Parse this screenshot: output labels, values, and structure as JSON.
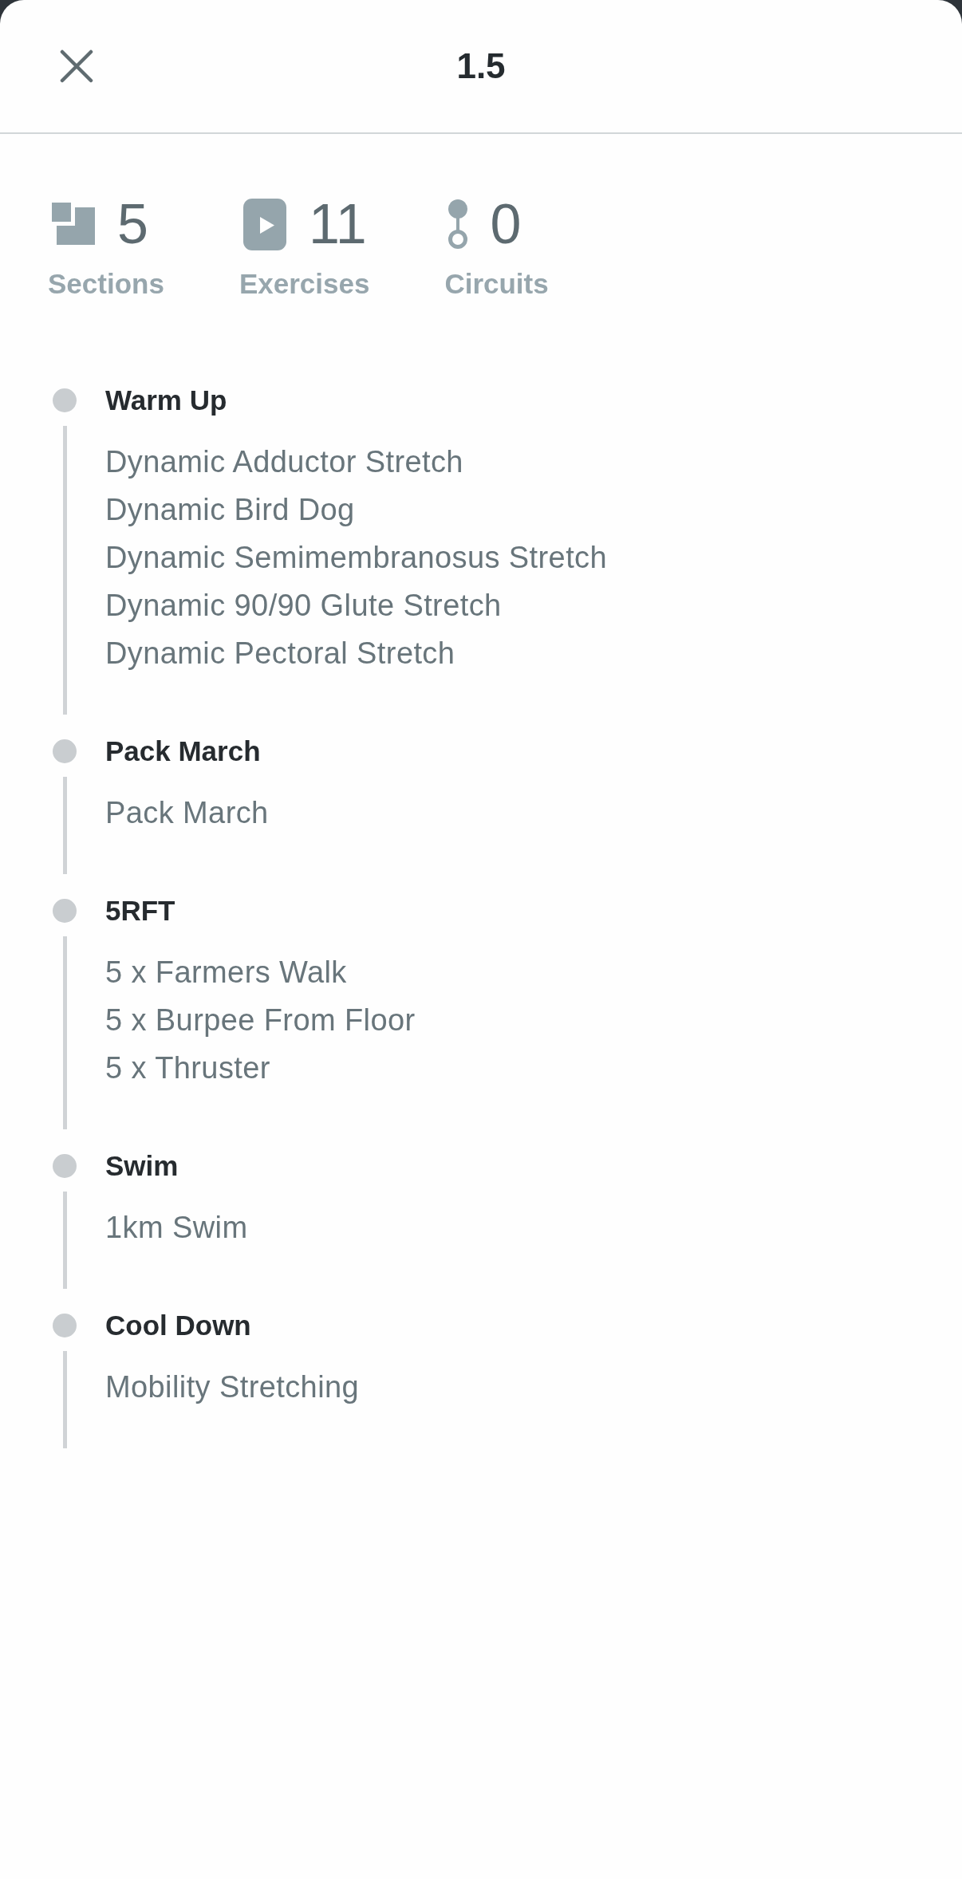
{
  "header": {
    "title": "1.5"
  },
  "stats": [
    {
      "kind": "sections",
      "value": "5",
      "label": "Sections"
    },
    {
      "kind": "exercises",
      "value": "11",
      "label": "Exercises"
    },
    {
      "kind": "circuits",
      "value": "0",
      "label": "Circuits"
    }
  ],
  "sections": [
    {
      "title": "Warm Up",
      "exercises": [
        "Dynamic Adductor Stretch",
        "Dynamic Bird Dog",
        "Dynamic Semimembranosus Stretch",
        "Dynamic 90/90 Glute Stretch",
        "Dynamic Pectoral Stretch"
      ]
    },
    {
      "title": "Pack March",
      "exercises": [
        "Pack March"
      ]
    },
    {
      "title": "5RFT",
      "exercises": [
        "5 x Farmers Walk",
        "5 x Burpee From Floor",
        "5 x Thruster"
      ]
    },
    {
      "title": "Swim",
      "exercises": [
        "1km Swim"
      ]
    },
    {
      "title": "Cool Down",
      "exercises": [
        "Mobility Stretching"
      ]
    }
  ]
}
